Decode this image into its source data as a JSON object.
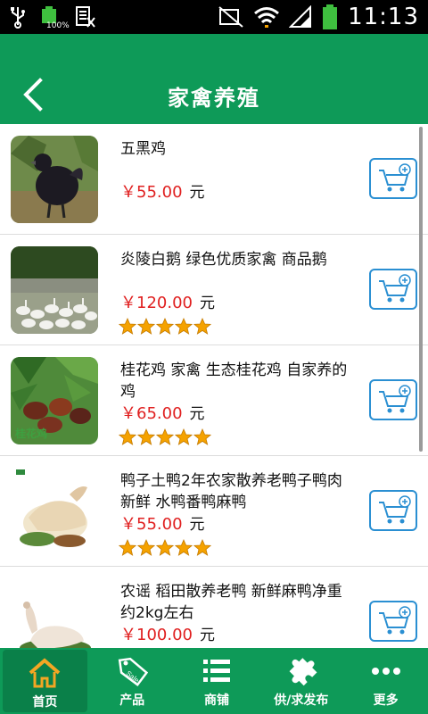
{
  "status_bar": {
    "battery_percent": "100%",
    "time": "11:13"
  },
  "header": {
    "title": "家禽养殖"
  },
  "products": [
    {
      "title": "五黑鸡",
      "price": "￥55.00",
      "unit": "元",
      "rating": 0
    },
    {
      "title": "炎陵白鹅 绿色优质家禽 商品鹅",
      "price": "￥120.00",
      "unit": "元",
      "rating": 5
    },
    {
      "title": "桂花鸡 家禽 生态桂花鸡 自家养的鸡",
      "price": "￥65.00",
      "unit": "元",
      "rating": 5,
      "image_text": "桂花鸡"
    },
    {
      "title": "鸭子土鸭2年农家散养老鸭子鸭肉新鲜 水鸭番鸭麻鸭",
      "price": "￥55.00",
      "unit": "元",
      "rating": 5
    },
    {
      "title": "农谣 稻田散养老鸭 新鲜麻鸭净重约2kg左右",
      "price": "￥100.00",
      "unit": "元",
      "rating": 0
    }
  ],
  "nav": [
    {
      "label": "首页",
      "icon": "home-icon",
      "active": true
    },
    {
      "label": "产品",
      "icon": "sale-tag-icon",
      "badge": "Sale"
    },
    {
      "label": "商铺",
      "icon": "list-icon"
    },
    {
      "label": "供/求发布",
      "icon": "puzzle-icon"
    },
    {
      "label": "更多",
      "icon": "more-dots-icon"
    }
  ],
  "colors": {
    "brand_green": "#0e9a58",
    "price_red": "#e02020",
    "cart_blue": "#2a8fd2",
    "star_orange": "#f5a200"
  }
}
